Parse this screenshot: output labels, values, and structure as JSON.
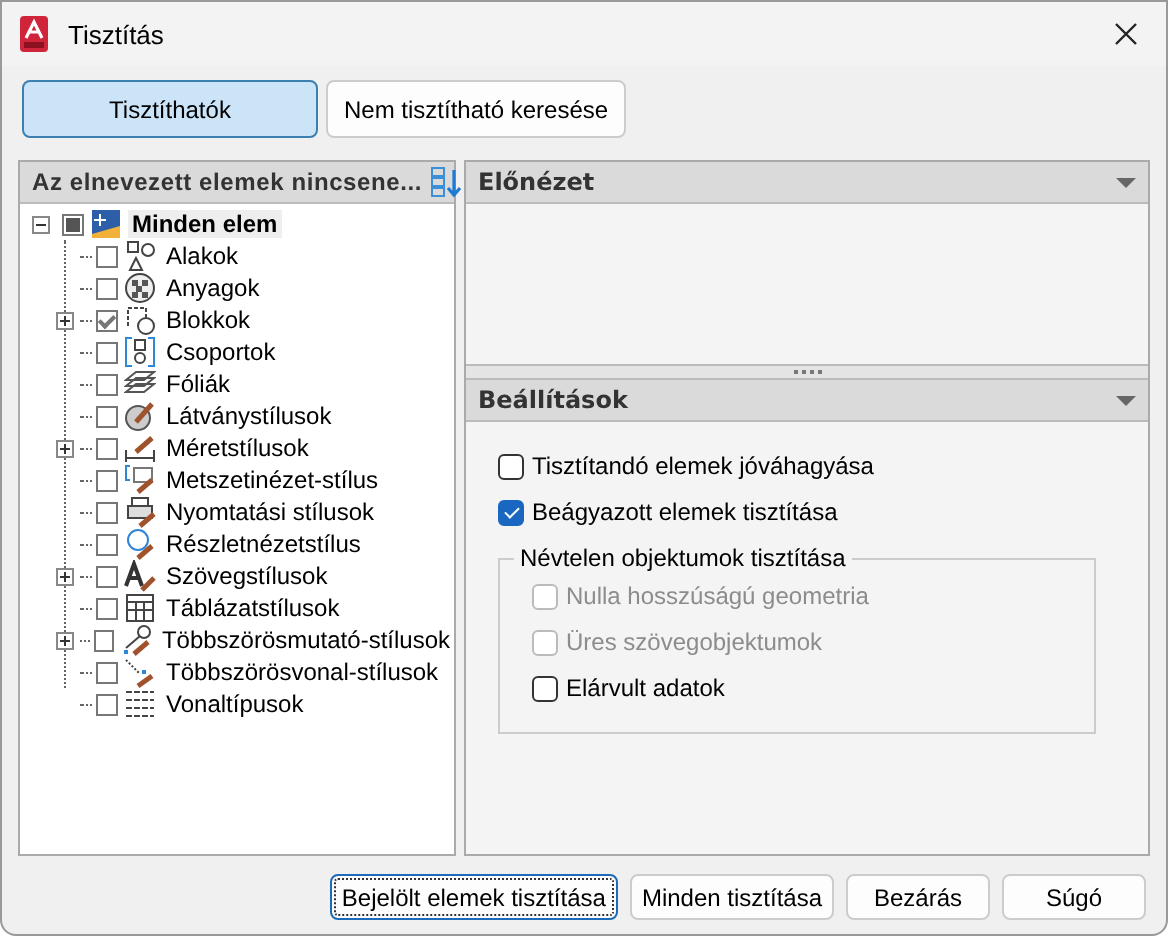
{
  "window": {
    "title": "Tisztítás"
  },
  "tabs": [
    {
      "label": "Tisztíthatók",
      "selected": true
    },
    {
      "label": "Nem tisztítható keresése",
      "selected": false
    }
  ],
  "tree_panel": {
    "title": "Az elnevezett elemek nincsene...",
    "root": {
      "label": "Minden elem",
      "expanded": true,
      "partial": true,
      "children": [
        {
          "label": "Alakok",
          "checked": false,
          "expandable": false
        },
        {
          "label": "Anyagok",
          "checked": false,
          "expandable": false
        },
        {
          "label": "Blokkok",
          "checked": true,
          "expandable": true
        },
        {
          "label": "Csoportok",
          "checked": false,
          "expandable": false
        },
        {
          "label": "Fóliák",
          "checked": false,
          "expandable": false
        },
        {
          "label": "Látványstílusok",
          "checked": false,
          "expandable": false
        },
        {
          "label": "Méretstílusok",
          "checked": false,
          "expandable": true
        },
        {
          "label": "Metszetinézet-stílus",
          "checked": false,
          "expandable": false
        },
        {
          "label": "Nyomtatási stílusok",
          "checked": false,
          "expandable": false
        },
        {
          "label": "Részletnézetstílus",
          "checked": false,
          "expandable": false
        },
        {
          "label": "Szövegstílusok",
          "checked": false,
          "expandable": true
        },
        {
          "label": "Táblázatstílusok",
          "checked": false,
          "expandable": false
        },
        {
          "label": "Többszörösmutató-stílusok",
          "checked": false,
          "expandable": true
        },
        {
          "label": "Többszörösvonal-stílusok",
          "checked": false,
          "expandable": false
        },
        {
          "label": "Vonaltípusok",
          "checked": false,
          "expandable": false
        }
      ]
    }
  },
  "preview": {
    "title": "Előnézet"
  },
  "settings": {
    "title": "Beállítások",
    "options": [
      {
        "label": "Tisztítandó elemek jóváhagyása",
        "checked": false,
        "disabled": false
      },
      {
        "label": "Beágyazott elemek tisztítása",
        "checked": true,
        "disabled": false
      }
    ],
    "group": {
      "title": "Névtelen objektumok tisztítása",
      "options": [
        {
          "label": "Nulla hosszúságú geometria",
          "checked": false,
          "disabled": true
        },
        {
          "label": "Üres szövegobjektumok",
          "checked": false,
          "disabled": true
        },
        {
          "label": "Elárvult adatok",
          "checked": false,
          "disabled": false
        }
      ]
    }
  },
  "buttons": [
    {
      "label": "Bejelölt elemek tisztítása",
      "focused": true
    },
    {
      "label": "Minden tisztítása",
      "focused": false
    },
    {
      "label": "Bezárás",
      "focused": false
    },
    {
      "label": "Súgó",
      "focused": false
    }
  ]
}
